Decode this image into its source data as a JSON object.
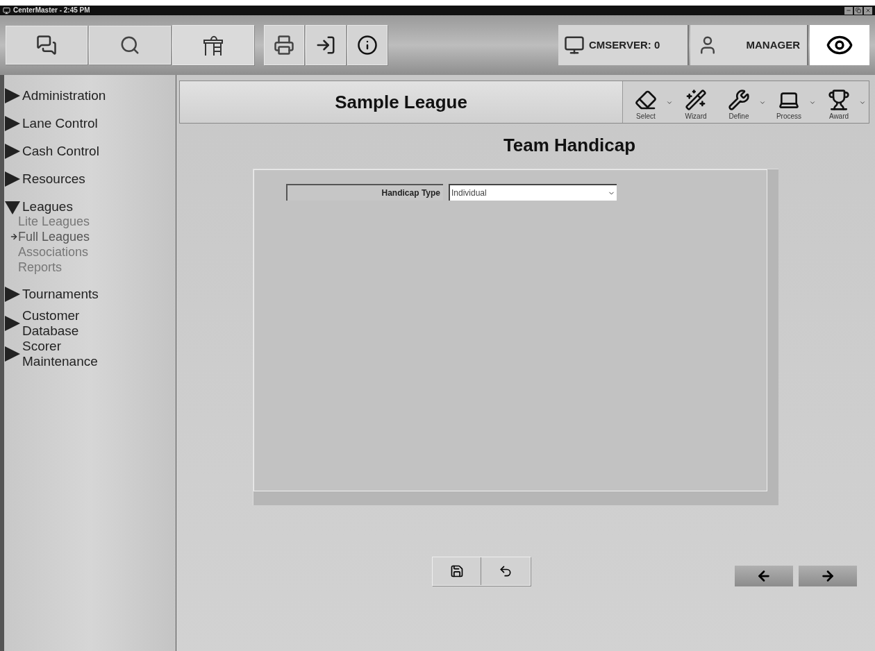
{
  "window": {
    "title": "CenterMaster - 2:45 PM"
  },
  "status": {
    "server": "CMSERVER: 0",
    "user": "MANAGER"
  },
  "sidebar": {
    "items": [
      {
        "label": "Administration",
        "expanded": false
      },
      {
        "label": "Lane Control",
        "expanded": false
      },
      {
        "label": "Cash Control",
        "expanded": false
      },
      {
        "label": "Resources",
        "expanded": false
      },
      {
        "label": "Leagues",
        "expanded": true,
        "children": [
          {
            "label": "Lite Leagues",
            "selected": false
          },
          {
            "label": "Full Leagues",
            "selected": true
          },
          {
            "label": "Associations",
            "selected": false
          },
          {
            "label": "Reports",
            "selected": false
          }
        ]
      },
      {
        "label": "Tournaments",
        "expanded": false
      },
      {
        "label": "Customer Database",
        "expanded": false
      },
      {
        "label": "Scorer Maintenance",
        "expanded": false
      }
    ]
  },
  "header": {
    "title": "Sample League",
    "actions": [
      {
        "kind": "select",
        "label": "Select",
        "dropdown": true
      },
      {
        "kind": "wizard",
        "label": "Wizard",
        "dropdown": false
      },
      {
        "kind": "define",
        "label": "Define",
        "dropdown": true
      },
      {
        "kind": "process",
        "label": "Process",
        "dropdown": true
      },
      {
        "kind": "award",
        "label": "Award",
        "dropdown": true
      }
    ]
  },
  "page": {
    "title": "Team Handicap",
    "fields": [
      {
        "label": "Handicap Type",
        "value": "Individual"
      }
    ]
  }
}
